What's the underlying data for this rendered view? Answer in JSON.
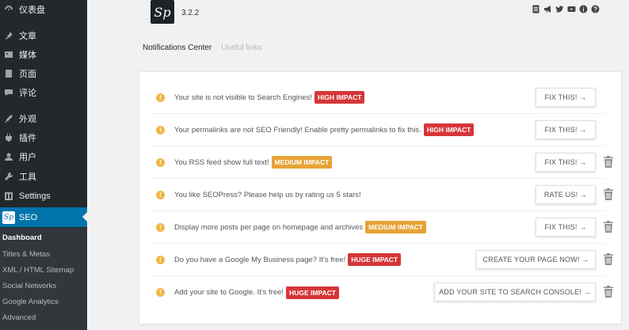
{
  "sidebar": {
    "items": [
      {
        "label": "仪表盘",
        "icon": "dashboard-icon"
      },
      {
        "label": "文章",
        "icon": "pin-icon"
      },
      {
        "label": "媒体",
        "icon": "media-icon"
      },
      {
        "label": "页面",
        "icon": "page-icon"
      },
      {
        "label": "评论",
        "icon": "comment-icon"
      },
      {
        "label": "外观",
        "icon": "appearance-icon"
      },
      {
        "label": "插件",
        "icon": "plugin-icon"
      },
      {
        "label": "用户",
        "icon": "user-icon"
      },
      {
        "label": "工具",
        "icon": "wrench-icon"
      },
      {
        "label": "Settings",
        "icon": "settings-icon"
      },
      {
        "label": "SEO",
        "icon": "seopress-icon"
      }
    ],
    "submenu": [
      "Dashboard",
      "Titles & Metas",
      "XML / HTML Sitemap",
      "Social Networks",
      "Google Analytics",
      "Advanced"
    ]
  },
  "header": {
    "logo_text": "Sp",
    "version": "3.2.2",
    "icons": [
      "document-icon",
      "megaphone-icon",
      "twitter-icon",
      "youtube-icon",
      "info-icon",
      "help-icon"
    ]
  },
  "tabs": {
    "active": "Notifications Center",
    "inactive": "Useful links"
  },
  "notifications": [
    {
      "message": "Your site is not visible to Search Engines!",
      "badge": "HIGH IMPACT",
      "badge_type": "high",
      "button": "FIX THIS! →",
      "trash": false
    },
    {
      "message": "Your permalinks are not SEO Friendly! Enable pretty permalinks to fix this.",
      "badge": "HIGH IMPACT",
      "badge_type": "high",
      "button": "FIX THIS! →",
      "trash": false
    },
    {
      "message": "You RSS feed show full text!",
      "badge": "MEDIUM IMPACT",
      "badge_type": "medium",
      "button": "FIX THIS! →",
      "trash": true
    },
    {
      "message": "You like SEOPress? Please help us by rating us 5 stars!",
      "badge": "",
      "badge_type": "none",
      "button": "RATE US! →",
      "trash": true
    },
    {
      "message": "Display more posts per page on homepage and archives",
      "badge": "MEDIUM IMPACT",
      "badge_type": "medium",
      "button": "FIX THIS! →",
      "trash": true
    },
    {
      "message": "Do you have a Google My Business page? It's free!",
      "badge": "HUGE IMPACT",
      "badge_type": "huge",
      "button": "CREATE YOUR PAGE NOW! →",
      "trash": true
    },
    {
      "message": "Add your site to Google. It's free!",
      "badge": "HUGE IMPACT",
      "badge_type": "huge",
      "button": "ADD YOUR SITE TO SEARCH CONSOLE! →",
      "trash": true
    }
  ],
  "colors": {
    "sidebar_bg": "#23282d",
    "active_menu": "#0073aa",
    "warning": "#f0b849",
    "high_impact": "#d63638",
    "medium_impact": "#e7a336"
  }
}
